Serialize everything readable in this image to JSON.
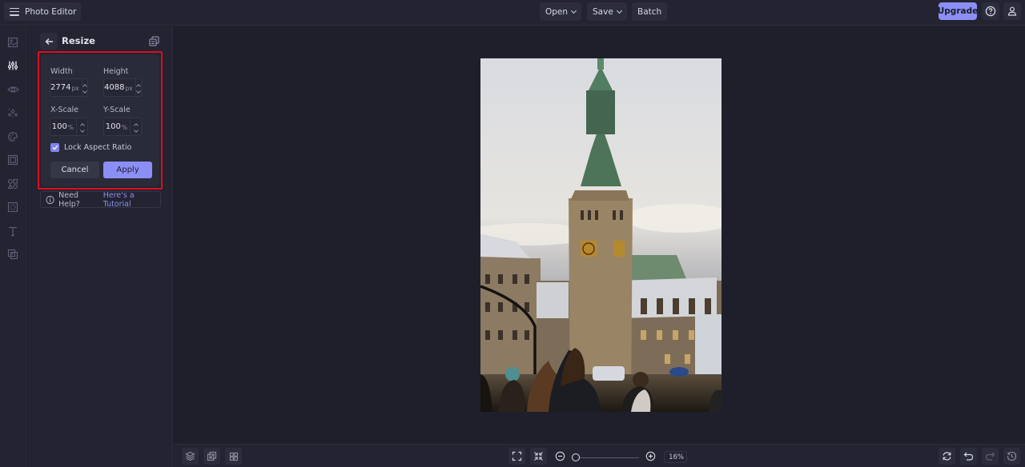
{
  "app": {
    "title": "Photo Editor",
    "menu_icon": "hamburger-menu-icon"
  },
  "toolbar": {
    "open_label": "Open",
    "save_label": "Save",
    "batch_label": "Batch",
    "upgrade_label": "Upgrade",
    "help_icon": "help-circle-icon",
    "account_icon": "user-icon"
  },
  "rail": {
    "items": [
      {
        "name": "image",
        "icon": "image-icon",
        "active": false
      },
      {
        "name": "edit",
        "icon": "sliders-icon",
        "active": true
      },
      {
        "name": "effects",
        "icon": "eye-icon",
        "active": false
      },
      {
        "name": "touch-up",
        "icon": "sparkle-icon",
        "active": false
      },
      {
        "name": "artsy",
        "icon": "palette-icon",
        "active": false
      },
      {
        "name": "frames",
        "icon": "frame-icon",
        "active": false
      },
      {
        "name": "graphics",
        "icon": "shapes-icon",
        "active": false
      },
      {
        "name": "textures",
        "icon": "texture-icon",
        "active": false
      },
      {
        "name": "text",
        "icon": "text-icon",
        "active": false
      },
      {
        "name": "overlays",
        "icon": "overlay-icon",
        "active": false
      }
    ]
  },
  "panel": {
    "title": "Resize",
    "width_label": "Width",
    "width_value": "2774",
    "width_unit": "px",
    "height_label": "Height",
    "height_value": "4088",
    "height_unit": "px",
    "xscale_label": "X-Scale",
    "xscale_value": "100",
    "xscale_unit": "%",
    "yscale_label": "Y-Scale",
    "yscale_value": "100",
    "yscale_unit": "%",
    "lock_label": "Lock Aspect Ratio",
    "lock_checked": true,
    "cancel_label": "Cancel",
    "apply_label": "Apply",
    "help_text": "Need Help?",
    "help_link": "Here's a Tutorial"
  },
  "canvas": {
    "image_alt": "Hamburg City Hall tower at sunset with people in foreground"
  },
  "bottombar": {
    "zoom_value": "16%",
    "zoom_fraction": 0.0
  },
  "colors": {
    "accent": "#8b8ff5",
    "highlight_border": "#e00c1c",
    "background": "#1f1f2c",
    "panel": "#232331"
  }
}
